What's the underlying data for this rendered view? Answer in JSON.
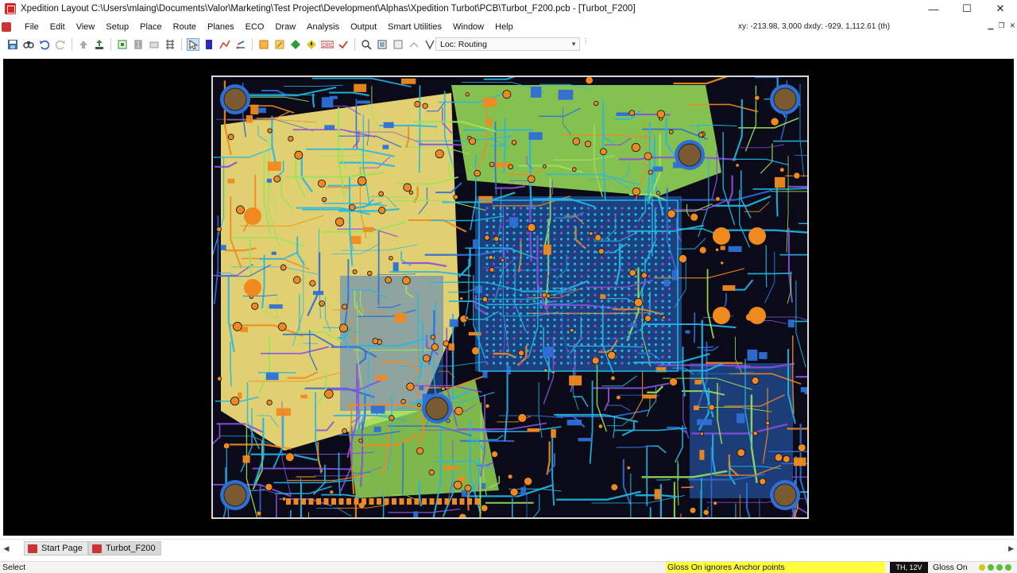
{
  "window": {
    "title": "Xpedition Layout  C:\\Users\\mlaing\\Documents\\Valor\\Marketing\\Test Project\\Development\\Alphas\\Xpedition Turbot\\PCB\\Turbot_F200.pcb - [Turbot_F200]",
    "minimize": "—",
    "maximize": "☐",
    "close": "✕"
  },
  "menu": {
    "items": [
      "File",
      "Edit",
      "View",
      "Setup",
      "Place",
      "Route",
      "Planes",
      "ECO",
      "Draw",
      "Analysis",
      "Output",
      "Smart Utilities",
      "Window",
      "Help"
    ],
    "coordinates": "xy: -213.98, 3,000  dxdy: -929, 1,112.61  (th)"
  },
  "toolbar": {
    "layer_combo_value": "Loc: Routing"
  },
  "board": {
    "colors": {
      "background": "#0a0a18",
      "silk_yellow": "#f4e27a",
      "trace_cyan": "#22b8e6",
      "trace_blue": "#2e6fd6",
      "trace_orange": "#f08a1e",
      "trace_purple": "#8a4fe0",
      "trace_green": "#9be25a",
      "mount_hole": "#7a5a30"
    }
  },
  "tabs": {
    "items": [
      "Start Page",
      "Turbot_F200"
    ],
    "active": "Turbot_F200"
  },
  "status": {
    "mode": "Select",
    "message": "Gloss On ignores Anchor points",
    "layer": "TH, 12V",
    "gloss": "Gloss On"
  }
}
